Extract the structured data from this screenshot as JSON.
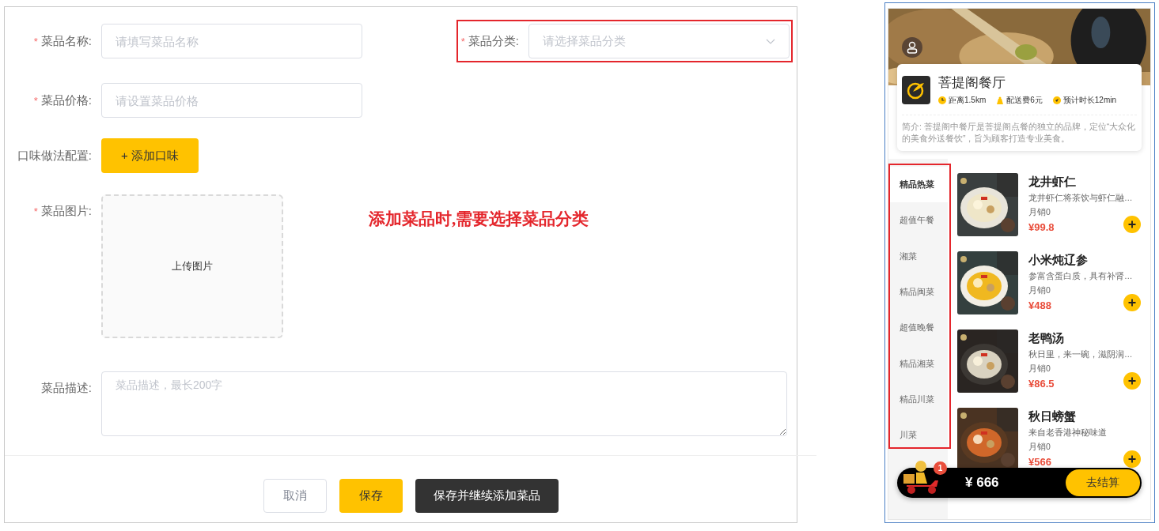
{
  "form": {
    "name_field": {
      "mark": "*",
      "label": "菜品名称:",
      "placeholder": "请填写菜品名称"
    },
    "category_field": {
      "mark": "*",
      "label": "菜品分类:",
      "placeholder": "请选择菜品分类",
      "annotated": true
    },
    "price_field": {
      "mark": "*",
      "label": "菜品价格:",
      "placeholder": "请设置菜品价格"
    },
    "flavor": {
      "label": "口味做法配置:",
      "button": "+ 添加口味"
    },
    "image": {
      "mark": "*",
      "label": "菜品图片:",
      "upload_text": "上传图片"
    },
    "description": {
      "label": "菜品描述:",
      "placeholder": "菜品描述，最长200字"
    }
  },
  "annotation": "添加菜品时,需要选择菜品分类",
  "footer_buttons": [
    {
      "label": "取消",
      "kind": "default"
    },
    {
      "label": "保存",
      "kind": "primary"
    },
    {
      "label": "保存并继续添加菜品",
      "kind": "dark"
    }
  ],
  "preview": {
    "restaurant": "菩提阁餐厅",
    "info": [
      {
        "kind": "distance",
        "text": "距离1.5km"
      },
      {
        "kind": "fee",
        "text": "配送费6元"
      },
      {
        "kind": "time",
        "text": "预计时长12min"
      }
    ],
    "intro": "简介: 菩提阁中餐厅是菩提阁点餐的独立的品牌，定位“大众化的美食外送餐饮”，旨为顾客打造专业美食。",
    "sidebar_annotated": true,
    "categories": [
      {
        "label": "精品热菜",
        "selected": true
      },
      {
        "label": "超值午餐",
        "selected": false
      },
      {
        "label": "湘菜",
        "selected": false
      },
      {
        "label": "精品闽菜",
        "selected": false
      },
      {
        "label": "超值晚餐",
        "selected": false
      },
      {
        "label": "精品湘菜",
        "selected": false
      },
      {
        "label": "精品川菜",
        "selected": false
      },
      {
        "label": "川菜",
        "selected": false
      }
    ],
    "dishes": [
      {
        "name": "龙井虾仁",
        "desc": "龙井虾仁将茶饮与虾仁融…",
        "sales": "月销0",
        "price": "¥99.8"
      },
      {
        "name": "小米炖辽参",
        "desc": "参富含蛋白质，具有补肾…",
        "sales": "月销0",
        "price": "¥488"
      },
      {
        "name": "老鸭汤",
        "desc": "秋日里，来一碗，滋阴润…",
        "sales": "月销0",
        "price": "¥86.5"
      },
      {
        "name": "秋日螃蟹",
        "desc": "来自老香港神秘味道",
        "sales": "月销0",
        "price": "¥566"
      }
    ],
    "cart": {
      "badge": "1",
      "total": "¥ 666",
      "checkout": "去结算"
    }
  }
}
